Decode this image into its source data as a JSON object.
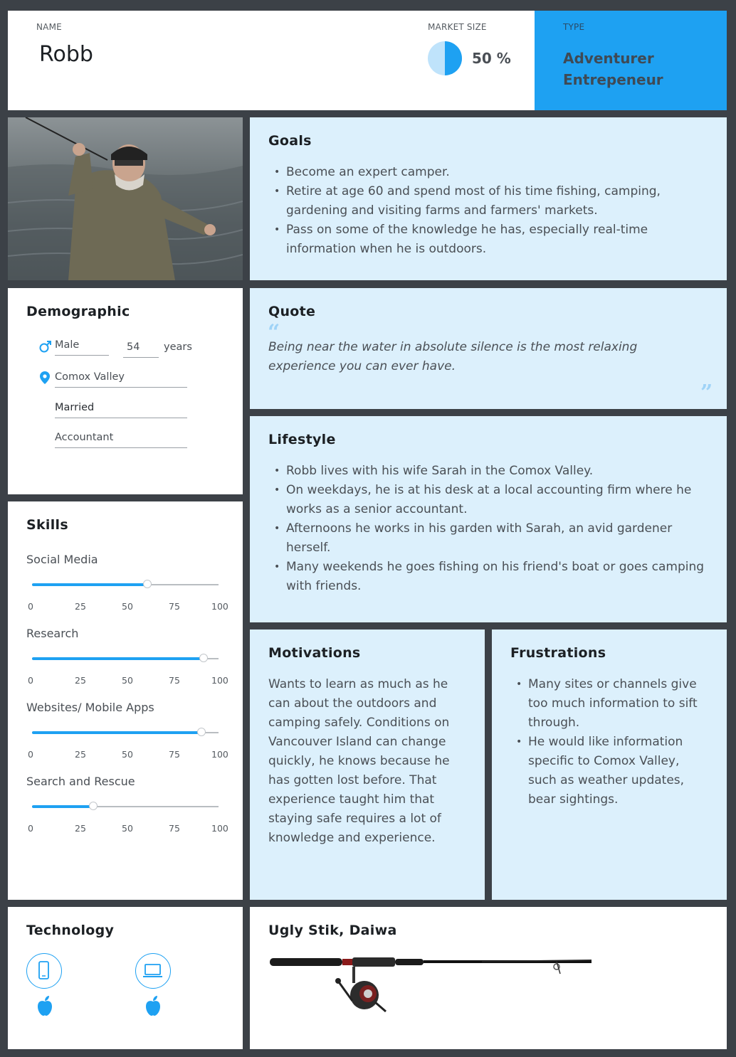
{
  "header": {
    "name_label": "NAME",
    "name": "Robb",
    "market_label": "MARKET SIZE",
    "market_value": "50 %",
    "market_fraction": 0.5,
    "type_label": "TYPE",
    "type_line1": "Adventurer",
    "type_line2": "Entrepeneur"
  },
  "photo": {
    "description_icon": "fisherman-photo"
  },
  "goals": {
    "title": "Goals",
    "items": [
      "Become an expert camper.",
      "Retire at age 60 and spend most of his time fishing, camping, gardening and visiting farms and farmers' markets.",
      "Pass on some of the knowledge he has, especially real-time information when he is outdoors."
    ]
  },
  "demographic": {
    "title": "Demographic",
    "gender": "Male",
    "age": "54",
    "age_unit": "years",
    "location": "Comox Valley",
    "status": "Married",
    "occupation": "Accountant"
  },
  "quote": {
    "title": "Quote",
    "text": "Being near the water in absolute silence is the most relaxing experience you can ever have."
  },
  "lifestyle": {
    "title": "Lifestyle",
    "items": [
      "Robb lives with his wife Sarah in the Comox Valley.",
      "On weekdays, he is at his desk at a local accounting firm where he works as a senior accountant.",
      "Afternoons he works in his garden with Sarah, an avid gardener herself.",
      "Many weekends he goes fishing on his friend's boat or goes camping with friends."
    ]
  },
  "skills": {
    "title": "Skills",
    "ticks": [
      "0",
      "25",
      "50",
      "75",
      "100"
    ],
    "items": [
      {
        "label": "Social Media",
        "value": 62
      },
      {
        "label": "Research",
        "value": 92
      },
      {
        "label": "Websites/ Mobile Apps",
        "value": 91
      },
      {
        "label": "Search and Rescue",
        "value": 33
      }
    ]
  },
  "motivations": {
    "title": "Motivations",
    "text": "Wants to learn as much as he can about the outdoors and camping safely. Conditions on Vancouver Island can change quickly, he knows because he has gotten lost before. That experience taught him that staying safe requires a lot of knowledge and experience."
  },
  "frustrations": {
    "title": "Frustrations",
    "items": [
      "Many sites or channels give too much information to sift through.",
      "He would like information specific to Comox Valley, such as weather updates, bear sightings."
    ]
  },
  "technology": {
    "title": "Technology",
    "devices": [
      "phone-icon",
      "laptop-icon"
    ],
    "platforms": [
      "apple-icon",
      "apple-icon"
    ]
  },
  "brand": {
    "title": "Ugly Stik, Daiwa"
  },
  "colors": {
    "accent": "#1ea1f2",
    "card_blue": "#dcf0fc",
    "background": "#3c4147"
  }
}
